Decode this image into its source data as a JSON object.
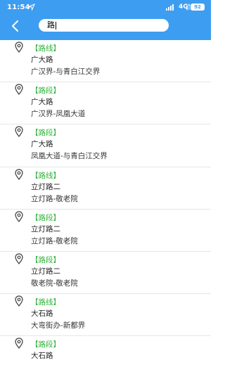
{
  "status": {
    "time": "11:54",
    "network": "4G",
    "battery": "92"
  },
  "search": {
    "value": "路"
  },
  "results": [
    {
      "tag": "【路线】",
      "name": "广大路",
      "desc": "广汉界-与青白江交界"
    },
    {
      "tag": "【路段】",
      "name": "广大路",
      "desc": "广汉界-凤凰大道"
    },
    {
      "tag": "【路段】",
      "name": "广大路",
      "desc": "凤凰大道-与青白江交界"
    },
    {
      "tag": "【路线】",
      "name": "立灯路二",
      "desc": "立灯路-敬老院"
    },
    {
      "tag": "【路段】",
      "name": "立灯路二",
      "desc": "立灯路-敬老院"
    },
    {
      "tag": "【路段】",
      "name": "立灯路二",
      "desc": "敬老院-敬老院"
    },
    {
      "tag": "【路线】",
      "name": "大石路",
      "desc": "大弯街办-新都界"
    },
    {
      "tag": "【路段】",
      "name": "大石路",
      "desc": ""
    }
  ],
  "colors": {
    "header": "#3d9df0",
    "tag": "#2fb23a"
  },
  "icons": {
    "back": "chevron-left-icon",
    "location": "location-arrow-icon",
    "pin": "map-pin-icon"
  }
}
